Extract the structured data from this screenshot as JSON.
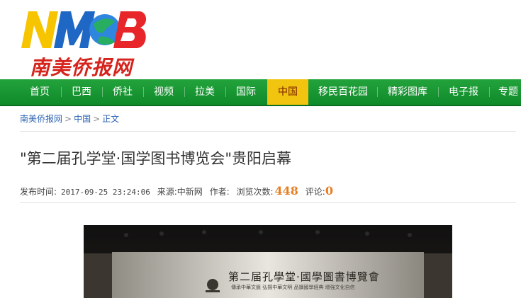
{
  "header": {
    "logo_letters": "NMB",
    "logo_text": "南美侨报网"
  },
  "nav": {
    "items": [
      {
        "label": "首页",
        "active": false
      },
      {
        "label": "巴西",
        "active": false
      },
      {
        "label": "侨社",
        "active": false
      },
      {
        "label": "视频",
        "active": false
      },
      {
        "label": "拉美",
        "active": false
      },
      {
        "label": "国际",
        "active": false
      },
      {
        "label": "中国",
        "active": true
      },
      {
        "label": "移民百花园",
        "active": false
      },
      {
        "label": "精彩图库",
        "active": false
      },
      {
        "label": "电子报",
        "active": false
      },
      {
        "label": "专题",
        "active": false
      }
    ]
  },
  "breadcrumb": {
    "home": "南美侨报网",
    "section": "中国",
    "current": "正文"
  },
  "article": {
    "title": "\"第二届孔学堂·国学图书博览会\"贵阳启幕",
    "publish_label": "发布时间:",
    "publish_time": "2017-09-25 23:24:06",
    "source_label": "来源:",
    "source": "中新网",
    "author_label": "作者:",
    "author": "",
    "views_label": "浏览次数:",
    "views": "448",
    "comments_label": "评论:",
    "comments": "0"
  },
  "photo": {
    "banner_title": "第二届孔學堂·國學圖書博覽會",
    "banner_sub": "傳承中華文脈  弘揚中華文明  品讀國學經典  增強文化自信"
  },
  "colors": {
    "nav_green": "#1a9a35",
    "nav_active": "#f1c40f",
    "link_blue": "#2b62b3",
    "count_orange": "#e67e22",
    "logo_red": "#d6231c"
  }
}
